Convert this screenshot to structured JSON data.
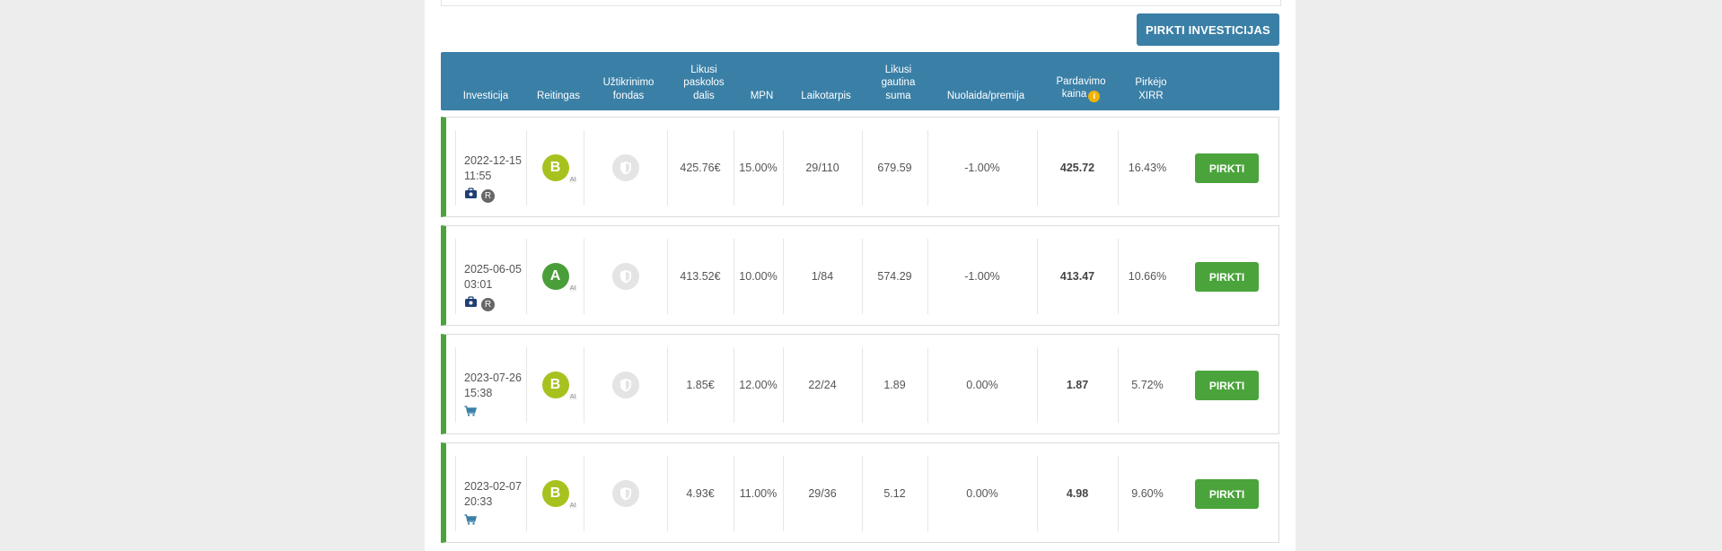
{
  "actions": {
    "buy_investments_label": "PIRKTI INVESTICIJAS"
  },
  "table": {
    "headers": {
      "investment": "Investicija",
      "rating": "Reitingas",
      "guarantee_fund": "Užtikrinimo\nfondas",
      "remaining_loan_part": "Likusi\npaskolos\ndalis",
      "mpn": "MPN",
      "term": "Laikotarpis",
      "remaining_amount": "Likusi\ngautina\nsuma",
      "discount": "Nuolaida/premija",
      "sale_price": "Pardavimo\nkaina",
      "sale_price_info": "i",
      "buyer_xirr": "Pirkėjo\nXIRR"
    },
    "rows": [
      {
        "date": "2022-12-15",
        "time": "11:55",
        "icons": [
          "briefcase-icon",
          "r-badge"
        ],
        "r_label": "R",
        "rating": "B",
        "rating_color": "#a7c21f",
        "ai_label": "AI",
        "loan_part": "425.76€",
        "mpn": "15.00%",
        "term": "29/110",
        "remaining": "679.59",
        "discount": "-1.00%",
        "price": "425.72",
        "xirr": "16.43%",
        "buy": "PIRKTI"
      },
      {
        "date": "2025-06-05",
        "time": "03:01",
        "icons": [
          "briefcase-icon",
          "r-badge"
        ],
        "r_label": "R",
        "rating": "A",
        "rating_color": "#4a9e3a",
        "ai_label": "AI",
        "loan_part": "413.52€",
        "mpn": "10.00%",
        "term": "1/84",
        "remaining": "574.29",
        "discount": "-1.00%",
        "price": "413.47",
        "xirr": "10.66%",
        "buy": "PIRKTI"
      },
      {
        "date": "2023-07-26",
        "time": "15:38",
        "icons": [
          "cart-icon"
        ],
        "r_label": "",
        "rating": "B",
        "rating_color": "#a7c21f",
        "ai_label": "AI",
        "loan_part": "1.85€",
        "mpn": "12.00%",
        "term": "22/24",
        "remaining": "1.89",
        "discount": "0.00%",
        "price": "1.87",
        "xirr": "5.72%",
        "buy": "PIRKTI"
      },
      {
        "date": "2023-02-07",
        "time": "20:33",
        "icons": [
          "cart-icon"
        ],
        "r_label": "",
        "rating": "B",
        "rating_color": "#a7c21f",
        "ai_label": "AI",
        "loan_part": "4.93€",
        "mpn": "11.00%",
        "term": "29/36",
        "remaining": "5.12",
        "discount": "0.00%",
        "price": "4.98",
        "xirr": "9.60%",
        "buy": "PIRKTI"
      }
    ]
  },
  "colors": {
    "header_bg": "#3a7fa6",
    "buy_green": "#4aa43b",
    "row_accent": "#4aa43b"
  }
}
